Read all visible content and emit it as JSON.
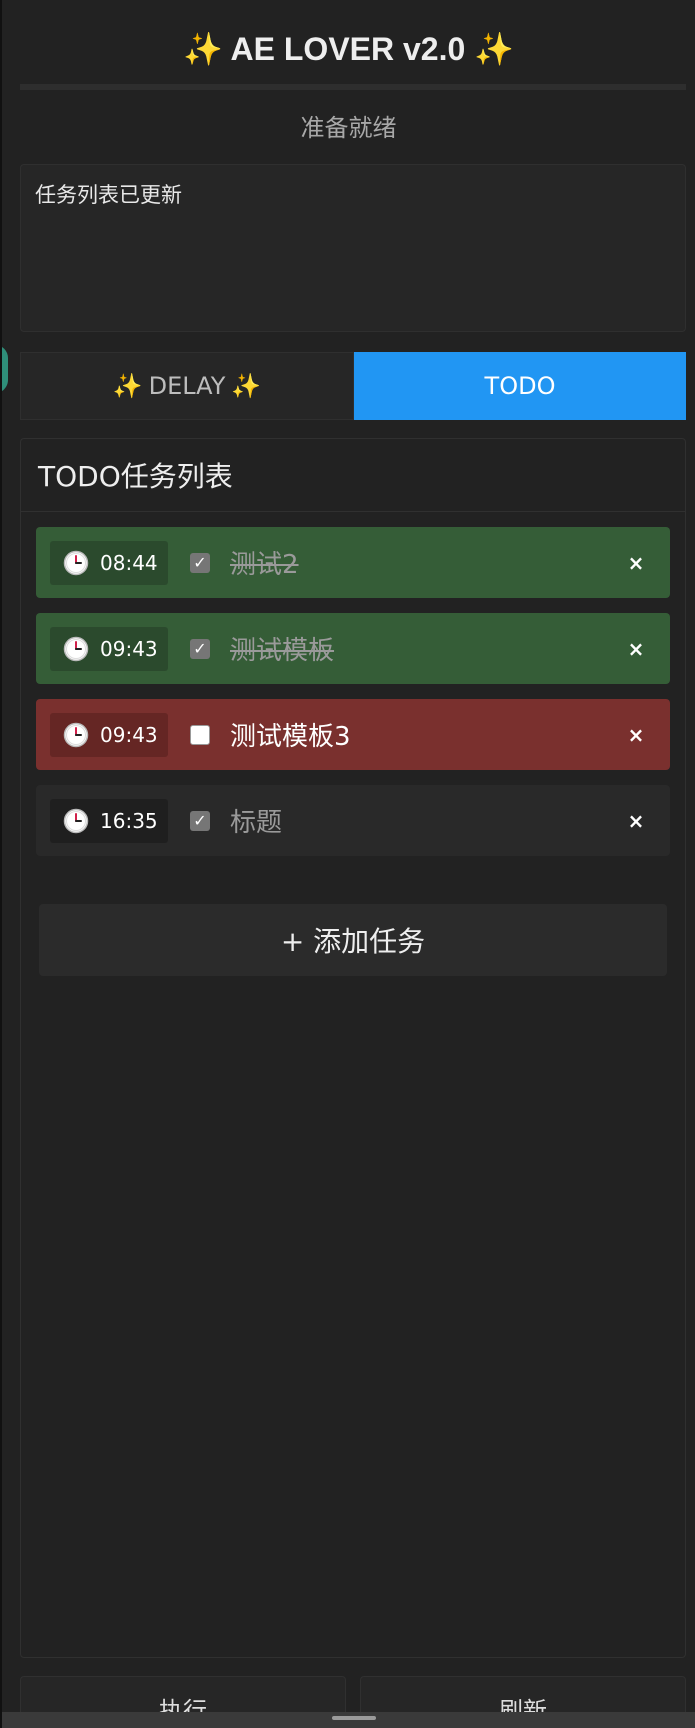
{
  "app": {
    "title_sparkle_left": "✨",
    "title": "AE LOVER v2.0",
    "title_sparkle_right": "✨"
  },
  "status": "准备就绪",
  "log": {
    "message": "任务列表已更新"
  },
  "tabs": [
    {
      "sparkle_left": "✨",
      "label": "DELAY",
      "sparkle_right": "✨",
      "active": false
    },
    {
      "label": "TODO",
      "active": true
    }
  ],
  "todo": {
    "header": "TODO任务列表",
    "tasks": [
      {
        "time": "08:44",
        "title": "测试2",
        "checked": true,
        "state": "done"
      },
      {
        "time": "09:43",
        "title": "测试模板",
        "checked": true,
        "state": "done"
      },
      {
        "time": "09:43",
        "title": "测试模板3",
        "checked": false,
        "state": "overdue"
      },
      {
        "time": "16:35",
        "title": "标题",
        "checked": true,
        "state": "plain"
      }
    ],
    "delete_label": "×",
    "add_button": "+ 添加任务"
  },
  "bottom_buttons": {
    "execute": "执行",
    "refresh": "刷新"
  },
  "icons": {
    "clock": "clock-icon",
    "check": "checkmark-icon",
    "close": "close-icon"
  },
  "colors": {
    "accent": "#2196f3",
    "done": "#355d37",
    "overdue": "#7a302e",
    "sparkle": "#f5c542"
  }
}
